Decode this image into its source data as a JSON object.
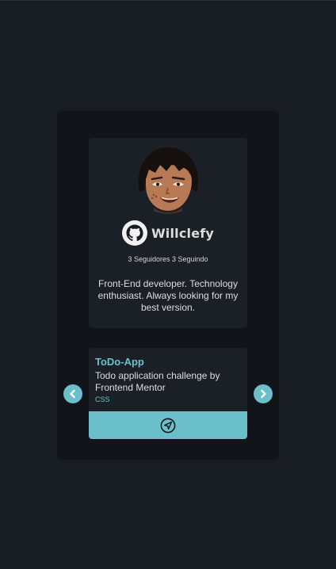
{
  "profile": {
    "username": "Willclefy",
    "stats": "3 Seguidores 3 Seguindo",
    "bio": "Front-End developer. Technology enthusiast. Always looking for my best version."
  },
  "repo": {
    "name": "ToDo-App",
    "description": "Todo application challenge by Frontend Mentor",
    "language": "CSS"
  },
  "icons": {
    "logo": "github-icon",
    "link": "send-icon",
    "prev": "chevron-left-icon",
    "next": "chevron-right-icon"
  },
  "colors": {
    "background": "#181c23",
    "panel": "#111419",
    "card": "#1b1f26",
    "accent": "#6bbfcb"
  }
}
